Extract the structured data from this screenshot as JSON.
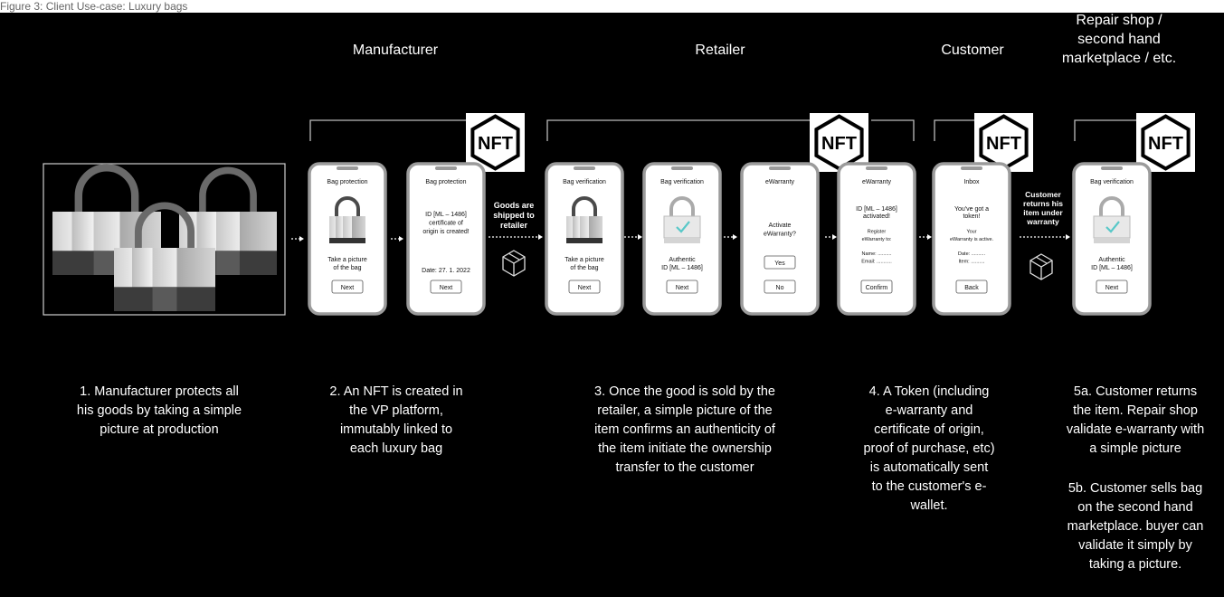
{
  "caption": "Figure 3: Client Use-case: Luxury bags",
  "colors": {
    "background": "#000000",
    "text": "#ffffff",
    "phone_bg": "#ffffff",
    "phone_frame": "#9b9b9b",
    "accent_check": "#58c8c8"
  },
  "nft_label": "NFT",
  "stages": {
    "manufacturer": "Manufacturer",
    "retailer": "Retailer",
    "customer": "Customer",
    "repair": [
      "Repair shop /",
      "second hand",
      "marketplace / etc."
    ]
  },
  "transitions": {
    "shipped": [
      "Goods are",
      "shipped to",
      "retailer"
    ],
    "returns": [
      "Customer",
      "returns his",
      "item under",
      "warranty"
    ]
  },
  "phones": [
    {
      "title": "Bag protection",
      "lines_mid": [],
      "lines_bottom": [
        "Take a picture",
        "of the bag"
      ],
      "buttons": [
        "Next"
      ],
      "icon": "lock"
    },
    {
      "title": "Bag protection",
      "lines_mid": [
        "ID [ML – 1486]",
        "certificate of",
        "origin is created!"
      ],
      "lines_bottom": [
        "Date: 27. 1. 2022"
      ],
      "buttons": [
        "Next"
      ],
      "icon": "none"
    },
    {
      "title": "Bag verification",
      "lines_mid": [],
      "lines_bottom": [
        "Take a picture",
        "of the bag"
      ],
      "buttons": [
        "Next"
      ],
      "icon": "lock"
    },
    {
      "title": "Bag verification",
      "lines_mid": [],
      "lines_bottom": [
        "Authentic",
        "ID [ML – 1486]"
      ],
      "buttons": [
        "Next"
      ],
      "icon": "check-lock"
    },
    {
      "title": "eWarranty",
      "lines_mid": [
        "Activate",
        "eWarranty?"
      ],
      "lines_bottom": [],
      "buttons": [
        "Yes",
        "No"
      ],
      "icon": "none"
    },
    {
      "title": "eWarranty",
      "lines_mid": [
        "ID [ML – 1486]",
        "activated!",
        "",
        "Register",
        "eWarranty to:",
        "",
        "Name: ..........",
        "Email: ..........."
      ],
      "lines_bottom": [],
      "buttons": [
        "Confirm"
      ],
      "icon": "none"
    },
    {
      "title": "Inbox",
      "lines_mid": [
        "You've got a",
        "token!",
        "",
        "Your",
        "eWarranty is active.",
        "",
        "Date: ..........",
        "Item: .........."
      ],
      "lines_bottom": [],
      "buttons": [
        "Back"
      ],
      "icon": "none"
    },
    {
      "title": "Bag verification",
      "lines_mid": [],
      "lines_bottom": [
        "Authentic",
        "ID [ML – 1486]"
      ],
      "buttons": [
        "Next"
      ],
      "icon": "check-lock"
    }
  ],
  "descriptions": {
    "d1": [
      "1. Manufacturer protects all",
      "his goods by taking a simple",
      "picture at production"
    ],
    "d2": [
      "2.  An NFT is created in",
      "the VP platform,",
      "immutably linked to",
      "each luxury bag"
    ],
    "d3": [
      "3. Once the good is sold by the",
      "retailer, a simple picture of the",
      "item confirms an authenticity of",
      "the item initiate the ownership",
      "transfer to the customer"
    ],
    "d4": [
      "4. A Token (including",
      "e-warranty and",
      "certificate of origin,",
      "proof of purchase, etc)",
      "is automatically sent",
      "to the customer's e-",
      "wallet."
    ],
    "d5a": [
      "5a. Customer returns",
      "the item. Repair shop",
      "validate e-warranty with",
      "a simple picture"
    ],
    "d5b": [
      "5b. Customer sells bag",
      "on the second hand",
      "marketplace. buyer can",
      "validate it simply by",
      "taking a picture."
    ]
  }
}
